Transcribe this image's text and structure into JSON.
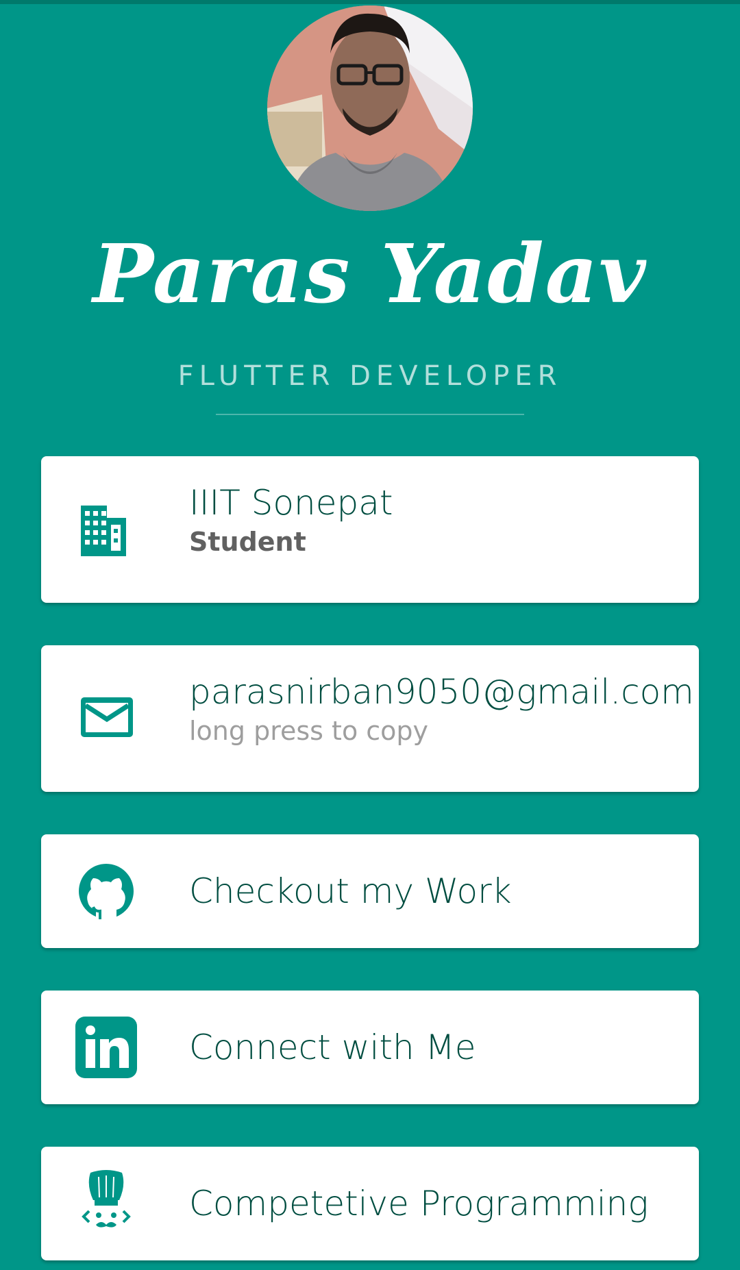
{
  "profile": {
    "name": "Paras Yadav",
    "title": "FLUTTER DEVELOPER"
  },
  "cards": [
    {
      "icon": "building-icon",
      "primary": "IIIT Sonepat",
      "secondary": "Student"
    },
    {
      "icon": "mail-icon",
      "primary": "parasnirban9050@gmail.com",
      "secondary": "long press to copy"
    },
    {
      "icon": "github-icon",
      "primary": "Checkout my Work"
    },
    {
      "icon": "linkedin-icon",
      "primary": "Connect with Me"
    },
    {
      "icon": "codechef-icon",
      "primary": "Competetive Programming"
    }
  ],
  "colors": {
    "background": "#009688",
    "card": "#ffffff",
    "accent": "#009688",
    "primary_text": "#004d40"
  }
}
